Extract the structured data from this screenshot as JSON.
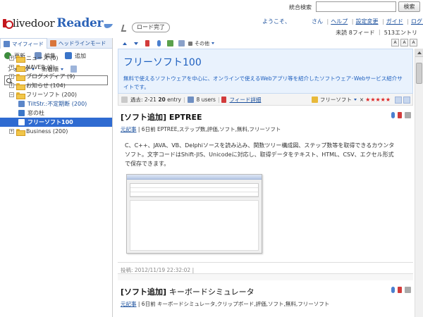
{
  "app": {
    "logo_text": "livedoor",
    "logo_strong": "Reader"
  },
  "header": {
    "search_label": "統合検索",
    "search_value": "",
    "search_button": "検索",
    "welcome": "ようこそ、",
    "honorific": "さん",
    "links": [
      "ヘルプ",
      "設定変更",
      "ガイド",
      "ログアウト"
    ],
    "unread_count": "未読 8フィード ｜ 513エントリ"
  },
  "loader": {
    "status": "ロード完了"
  },
  "subtoolbar": {
    "others_label": "その他",
    "size_buttons": [
      "A",
      "A",
      "A"
    ]
  },
  "sidebar": {
    "tabs": [
      "マイフィード",
      "ヘッドラインモード"
    ],
    "actions": [
      "更新",
      "編集",
      "追加"
    ],
    "sort": {
      "folder": "フォルダ",
      "order": "新着順"
    },
    "search_value": "",
    "tree": [
      {
        "label": "ニュース (0)",
        "type": "folder",
        "expand": "+",
        "indent": 0
      },
      {
        "label": "NAVER (0)",
        "type": "folder",
        "expand": "+",
        "indent": 0
      },
      {
        "label": "ブログメディア (9)",
        "type": "folder",
        "expand": "+",
        "indent": 0
      },
      {
        "label": "お知らせ (104)",
        "type": "folder",
        "expand": "+",
        "indent": 0
      },
      {
        "label": "フリーソフト (200)",
        "type": "folder",
        "expand": "−",
        "indent": 0
      },
      {
        "label": "TiltStr.:不定期断 (200)",
        "type": "feed",
        "indent": 1,
        "color": "#5b86c9"
      },
      {
        "label": "窓の杜",
        "type": "feed",
        "indent": 1,
        "color": "#3b77c9"
      },
      {
        "label": "フリーソフト100",
        "type": "feed",
        "indent": 1,
        "color": "#2f6bd1",
        "selected": true
      },
      {
        "label": "Business (200)",
        "type": "folder",
        "expand": "+",
        "indent": 0
      }
    ]
  },
  "feed": {
    "title": "フリーソフト100",
    "description": "無料で使えるソフトウェアを中心に、オンラインで使えるWebアプリ等を紹介したソフトウェア･Webサービス紹介サイトです。",
    "period": "過去: 2-21",
    "entries": "20",
    "entries_unit": "entry",
    "users": "8 users",
    "detail_link": "フィード詳細",
    "folder": "フリーソフト",
    "rating": 5
  },
  "entries": [
    {
      "title_bracket": "[ソフト追加]",
      "title_rest": "EPTREE",
      "bold_rest": true,
      "source": "元記事",
      "sub": "| 6日前 EPTREE,ステップ数,評価,ソフト,無料,フリーソフト",
      "body": "C、C++、JAVA、VB、Delphiソースを読み込み、関数ツリー構成図、ステップ数等を取得できるカウンタソフト。文字コードはShift-JIS、Unicodeに対応し、取得データをテキスト、HTML、CSV、エクセル形式で保存できます。",
      "footer": "投稿: 2012/11/19 22:32:02 |"
    },
    {
      "title_bracket": "[ソフト追加]",
      "title_rest": "キーボードシミュレータ",
      "bold_rest": false,
      "source": "元記事",
      "sub": "| 6日前 キーボードシミュレータ,クリップボード,評価,ソフト,無料,フリーソフト",
      "body": "",
      "footer": ""
    }
  ],
  "colors": {
    "accent": "#1d5fbf",
    "selected": "#2f6bd1",
    "feed_bg": "#e9f2fd",
    "star": "#dd2222"
  }
}
